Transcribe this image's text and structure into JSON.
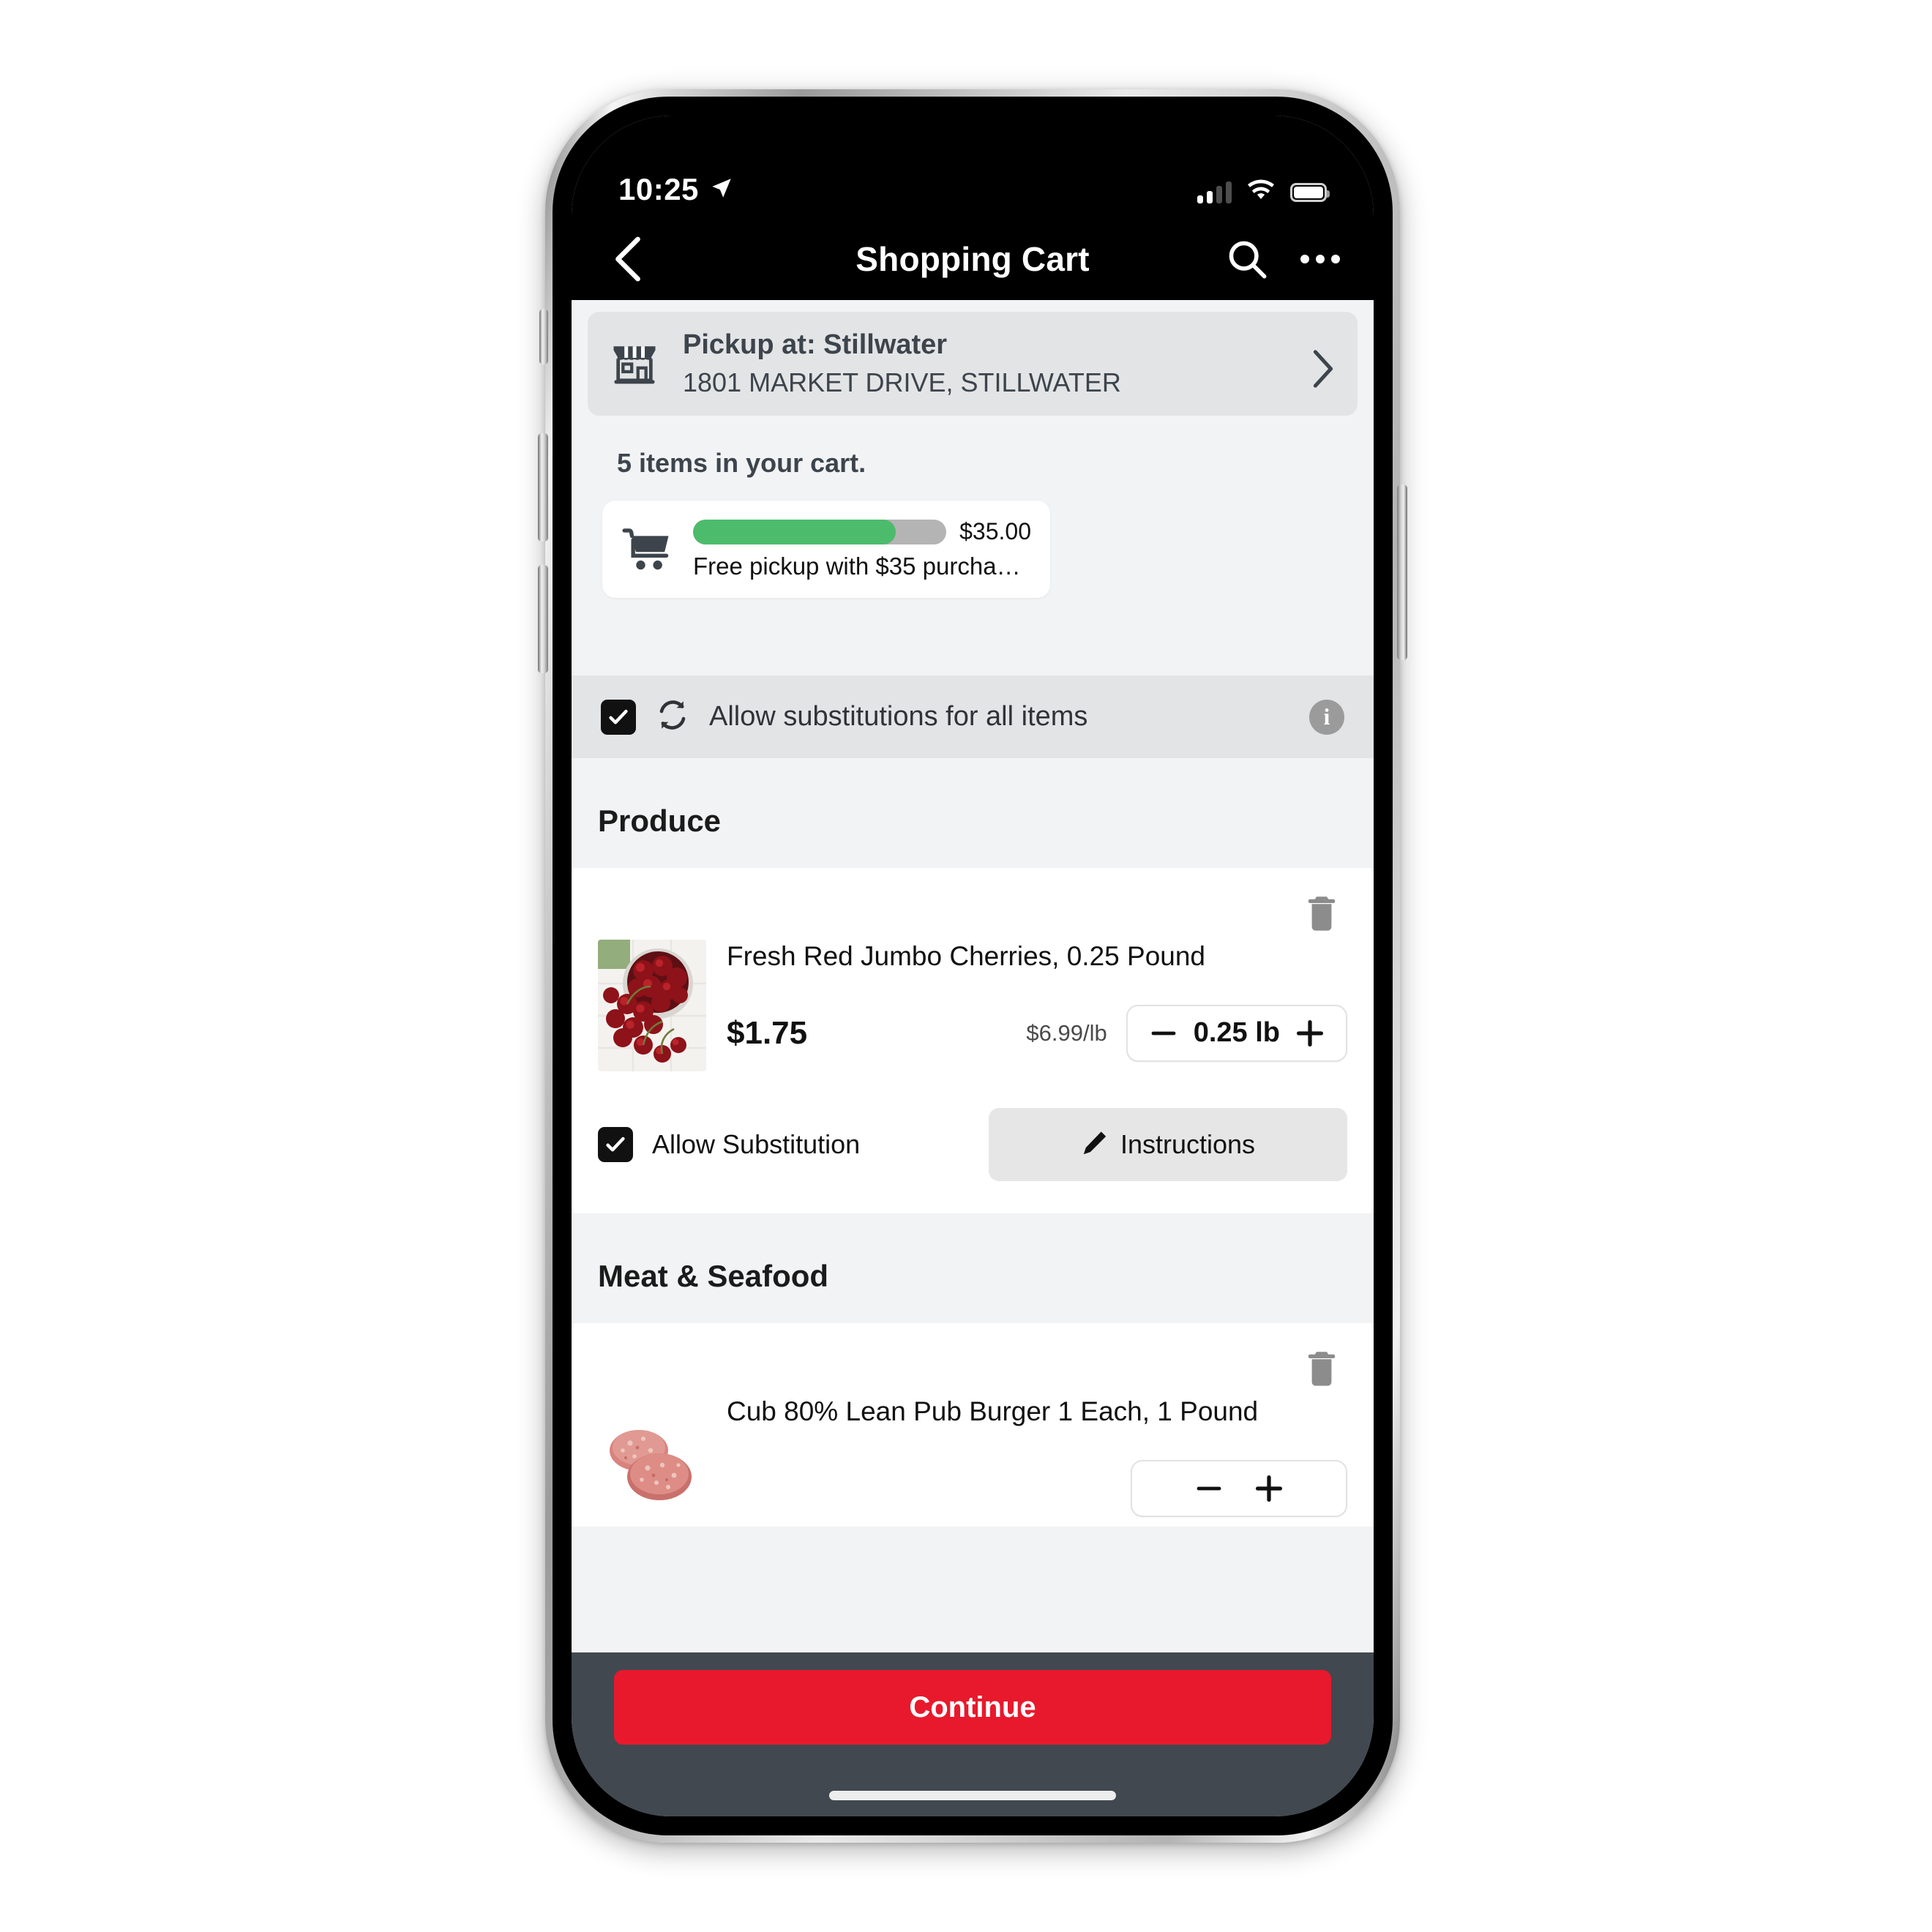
{
  "status_bar": {
    "time": "10:25",
    "location_icon": "location-arrow-icon",
    "signal_icon": "cellular-signal-icon",
    "wifi_icon": "wifi-icon",
    "battery_icon": "battery-full-icon"
  },
  "nav": {
    "back_icon": "chevron-left-icon",
    "title": "Shopping Cart",
    "search_icon": "search-icon",
    "more_icon": "more-options-icon"
  },
  "pickup": {
    "store_icon": "storefront-icon",
    "title": "Pickup at: Stillwater",
    "address": "1801 MARKET DRIVE, STILLWATER",
    "chevron_icon": "chevron-right-icon"
  },
  "cart": {
    "items_count_text": "5 items in your cart.",
    "cart_icon": "shopping-cart-icon",
    "progress_amount": "$35.00",
    "progress_note": "Free pickup with $35 purchase...",
    "progress_percent": 80,
    "progress_fill_color": "#4cbb6c",
    "progress_track_color": "#b4b4b4"
  },
  "substitutions": {
    "checked": true,
    "refresh_icon": "substitution-refresh-icon",
    "label": "Allow substitutions for all items",
    "info_icon": "info-icon",
    "info_glyph": "i"
  },
  "sections": [
    {
      "title": "Produce",
      "items": [
        {
          "delete_icon": "trash-icon",
          "image_alt": "fresh-red-jumbo-cherries-image",
          "name": "Fresh Red Jumbo Cherries, 0.25 Pound",
          "price": "$1.75",
          "unit_price": "$6.99/lb",
          "decrement_label": "−",
          "quantity": "0.25 lb",
          "increment_label": "+",
          "allow_substitution_checked": true,
          "allow_substitution_label": "Allow Substitution",
          "instructions_icon": "pencil-icon",
          "instructions_label": "Instructions"
        }
      ]
    },
    {
      "title": "Meat & Seafood",
      "items": [
        {
          "delete_icon": "trash-icon",
          "image_alt": "cub-lean-pub-burger-image",
          "name": "Cub 80% Lean Pub Burger 1 Each, 1 Pound",
          "price": "",
          "unit_price": "",
          "decrement_label": "−",
          "quantity": "",
          "increment_label": "+",
          "allow_substitution_checked": true,
          "allow_substitution_label": "",
          "instructions_icon": "pencil-icon",
          "instructions_label": ""
        }
      ]
    }
  ],
  "bottom": {
    "continue_label": "Continue",
    "continue_color": "#e8192c",
    "bar_color": "#414850",
    "home_indicator": "home-indicator"
  }
}
